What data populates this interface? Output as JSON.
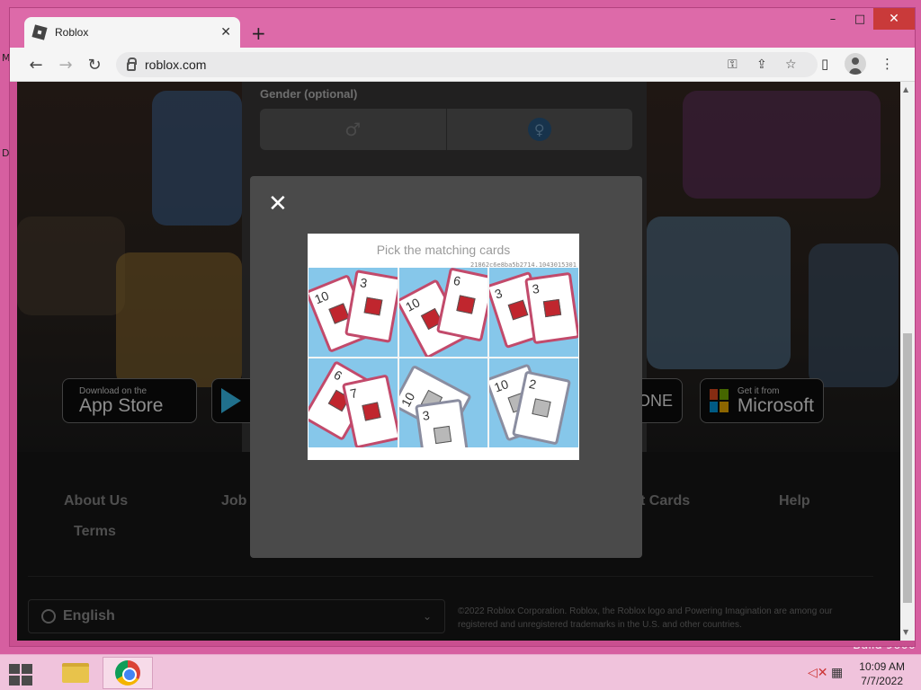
{
  "desktop": {
    "edge_label_1": "M",
    "edge_label_2": "D",
    "build_text": "Build 9600"
  },
  "window_controls": {
    "minimize": "–",
    "maximize": "□",
    "close": "✕"
  },
  "tab": {
    "title": "Roblox",
    "close": "✕",
    "new_tab": "+"
  },
  "toolbar": {
    "back": "←",
    "forward": "→",
    "reload": "↻",
    "url": "roblox.com",
    "key_icon": "key",
    "share_icon": "share",
    "star_icon": "☆",
    "sidepanel_icon": "▯",
    "menu_icon": "⋮"
  },
  "signup_form": {
    "gender_label": "Gender (optional)",
    "male_symbol": "♂",
    "female_symbol": "♀"
  },
  "store_badges": {
    "app_store_small": "Download on the",
    "app_store_big": "App Store",
    "one_text": "ONE",
    "microsoft_small": "Get it from",
    "microsoft_big": "Microsoft"
  },
  "footer": {
    "links": [
      "About Us",
      "Job",
      "t Cards",
      "Help",
      "Terms"
    ],
    "language": "English",
    "copyright": "©2022 Roblox Corporation. Roblox, the Roblox logo and Powering Imagination are among our registered and unregistered trademarks in the U.S. and other countries."
  },
  "modal": {
    "close": "✕",
    "captcha_title": "Pick the matching cards",
    "captcha_id": "21862c6e8ba5b2714.1043015301",
    "cells": [
      {
        "cards": [
          {
            "num": "10",
            "grey": false
          },
          {
            "num": "3",
            "grey": false
          }
        ]
      },
      {
        "cards": [
          {
            "num": "10",
            "grey": false
          },
          {
            "num": "6",
            "grey": false
          }
        ]
      },
      {
        "cards": [
          {
            "num": "3",
            "grey": false
          },
          {
            "num": "3",
            "grey": false
          }
        ]
      },
      {
        "cards": [
          {
            "num": "6",
            "grey": false
          },
          {
            "num": "7",
            "grey": false
          }
        ]
      },
      {
        "cards": [
          {
            "num": "10",
            "grey": true
          },
          {
            "num": "3",
            "grey": true
          }
        ]
      },
      {
        "cards": [
          {
            "num": "10",
            "grey": true
          },
          {
            "num": "2",
            "grey": true
          }
        ]
      }
    ]
  },
  "taskbar": {
    "clock_time": "10:09 AM",
    "clock_date": "7/7/2022",
    "volume_icon": "🔇",
    "network_icon": "▦"
  },
  "colors": {
    "desktop": "#d65fa0",
    "modal_bg": "#4a4a4a",
    "card_red": "#c24a6b",
    "captcha_cell": "#86c7ea"
  }
}
